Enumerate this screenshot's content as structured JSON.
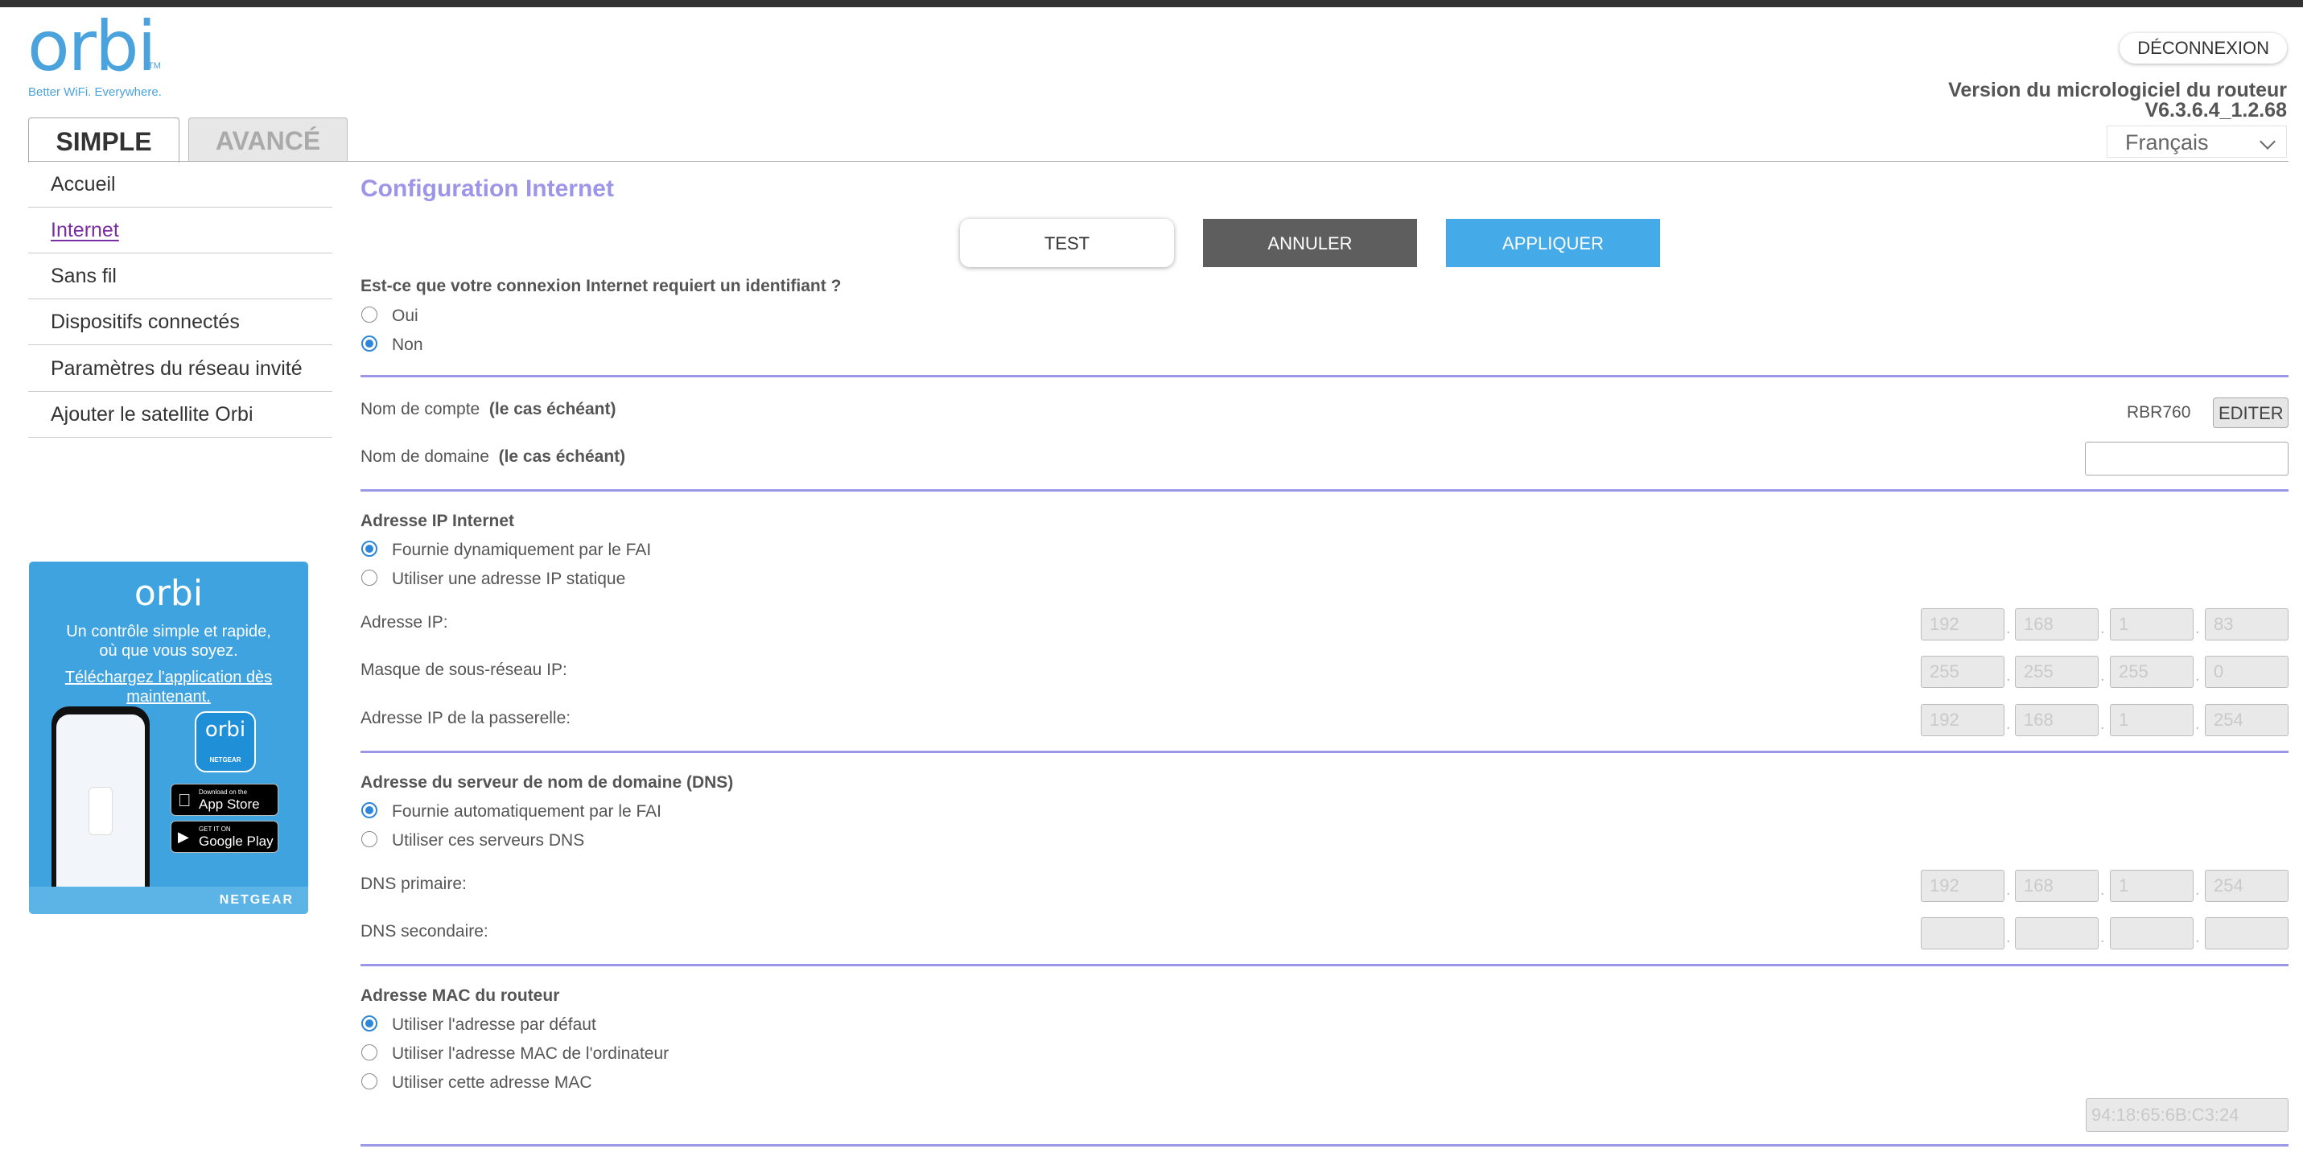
{
  "header": {
    "logo_text": "orbi",
    "logo_tm": "TM",
    "tagline": "Better WiFi. Everywhere.",
    "logout_label": "DÉCONNEXION",
    "firmware_label": "Version du micrologiciel du routeur",
    "firmware_version": "V6.3.6.4_1.2.68",
    "language": "Français"
  },
  "tabs": {
    "simple": "SIMPLE",
    "advanced": "AVANCÉ"
  },
  "sidebar": {
    "items": [
      {
        "label": "Accueil"
      },
      {
        "label": "Internet"
      },
      {
        "label": "Sans fil"
      },
      {
        "label": "Dispositifs connectés"
      },
      {
        "label": "Paramètres du réseau invité"
      },
      {
        "label": "Ajouter le satellite Orbi"
      }
    ]
  },
  "promo": {
    "logo": "orbi",
    "line1": "Un contrôle simple et rapide,",
    "line2": "où que vous soyez.",
    "download_link": "Téléchargez l'application dès maintenant.",
    "app_icon_text": "orbi",
    "app_icon_sub": "NETGEAR",
    "app_store_small": "Download on the",
    "app_store_big": "App Store",
    "google_small": "GET IT ON",
    "google_big": "Google Play",
    "brand": "NETGEAR"
  },
  "main": {
    "title": "Configuration Internet",
    "buttons": {
      "test": "TEST",
      "cancel": "ANNULER",
      "apply": "APPLIQUER"
    },
    "login_question": "Est-ce que votre connexion Internet requiert un identifiant ?",
    "login_options": [
      {
        "label": "Oui",
        "selected": false
      },
      {
        "label": "Non",
        "selected": true
      }
    ],
    "account_name_label": "Nom de compte",
    "account_name_hint": "(le cas échéant)",
    "account_name_value": "RBR760",
    "edit_label": "EDITER",
    "domain_name_label": "Nom de domaine",
    "domain_name_hint": "(le cas échéant)",
    "domain_name_value": "",
    "ip_section_title": "Adresse IP Internet",
    "ip_options": [
      {
        "label": "Fournie dynamiquement par le FAI",
        "selected": true
      },
      {
        "label": "Utiliser une adresse IP statique",
        "selected": false
      }
    ],
    "ip_address_label": "Adresse IP:",
    "ip_address": [
      "192",
      "168",
      "1",
      "83"
    ],
    "subnet_label": "Masque de sous-réseau IP:",
    "subnet": [
      "255",
      "255",
      "255",
      "0"
    ],
    "gateway_label": "Adresse IP de la passerelle:",
    "gateway": [
      "192",
      "168",
      "1",
      "254"
    ],
    "dns_section_title": "Adresse du serveur de nom de domaine (DNS)",
    "dns_options": [
      {
        "label": "Fournie automatiquement par le FAI",
        "selected": true
      },
      {
        "label": "Utiliser ces serveurs DNS",
        "selected": false
      }
    ],
    "dns_primary_label": "DNS primaire:",
    "dns_primary": [
      "192",
      "168",
      "1",
      "254"
    ],
    "dns_secondary_label": "DNS secondaire:",
    "dns_secondary": [
      "",
      "",
      "",
      ""
    ],
    "mac_section_title": "Adresse MAC du routeur",
    "mac_options": [
      {
        "label": "Utiliser l'adresse par défaut",
        "selected": true
      },
      {
        "label": "Utiliser l'adresse MAC de l'ordinateur",
        "selected": false
      },
      {
        "label": "Utiliser cette adresse MAC",
        "selected": false
      }
    ],
    "mac_value": "94:18:65:6B:C3:24"
  }
}
